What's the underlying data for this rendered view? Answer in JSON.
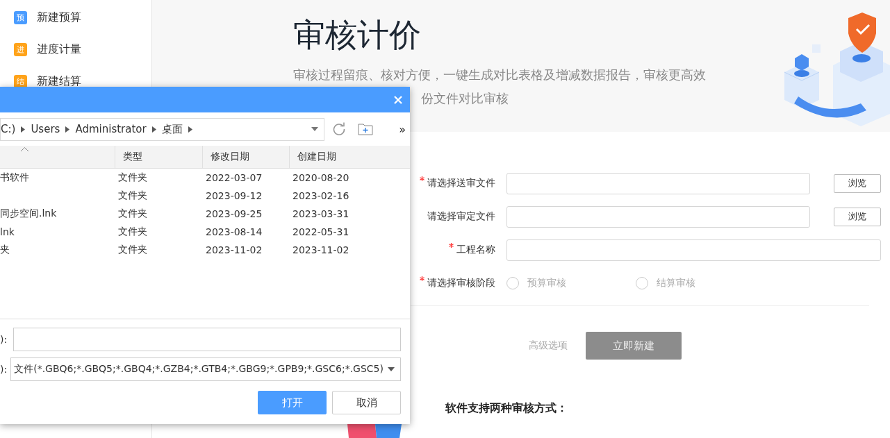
{
  "sidebar": {
    "items": [
      {
        "icon_char": "预",
        "label": "新建预算",
        "color": "#4a9cff"
      },
      {
        "icon_char": "进",
        "label": "进度计量",
        "color": "#ffa31a"
      },
      {
        "icon_char": "结",
        "label": "新建结算",
        "color": "#ffa31a"
      }
    ]
  },
  "header": {
    "title": "审核计价",
    "subtitle": "审核过程留痕、核对方便，一键生成对比表格及增减数据报告，审核更高效",
    "subtitle_line_2": "份文件对比审核"
  },
  "form": {
    "fields": [
      {
        "kind": "file",
        "label": "请选择送审文件",
        "required": true,
        "button": "浏览"
      },
      {
        "kind": "file",
        "label": "请选择审定文件",
        "required": false,
        "button": "浏览"
      },
      {
        "kind": "text",
        "label": "工程名称",
        "required": true
      },
      {
        "kind": "radio",
        "label": "请选择审核阶段",
        "required": true,
        "options": [
          {
            "label": "预算审核",
            "selected": false
          },
          {
            "label": "结算审核",
            "selected": false
          }
        ]
      }
    ],
    "advanced_link": "高级选项",
    "submit": {
      "label": "立即新建",
      "disabled": true
    }
  },
  "help": {
    "heading": "软件支持两种审核方式："
  },
  "dialog": {
    "address": {
      "segments": [
        "C:)",
        "Users",
        "Administrator",
        "桌面"
      ]
    },
    "more": "»",
    "columns": [
      "类型",
      "修改日期",
      "创建日期"
    ],
    "rows": [
      {
        "name": "书软件",
        "type": "文件夹",
        "modified": "2022-03-07",
        "created": "2020-08-20"
      },
      {
        "type": "文件夹",
        "modified": "2023-09-12",
        "created": "2023-02-16"
      },
      {
        "name": "同步空间.lnk",
        "type": "文件夹",
        "modified": "2023-09-25",
        "created": "2023-03-31"
      },
      {
        "name": "lnk",
        "type": "文件夹",
        "modified": "2023-08-14",
        "created": "2022-05-31"
      },
      {
        "name": "夹",
        "type": "文件夹",
        "modified": "2023-11-02",
        "created": "2023-11-02"
      }
    ],
    "filename": {
      "label": "):"
    },
    "filter": {
      "label": "):",
      "value": "文件(*.GBQ6;*.GBQ5;*.GBQ4;*.GZB4;*.GTB4;*.GBG9;*.GPB9;*.GSC6;*.GSC5)"
    },
    "buttons": [
      {
        "label": "打开",
        "primary": true
      },
      {
        "label": "取消",
        "primary": false
      }
    ]
  }
}
